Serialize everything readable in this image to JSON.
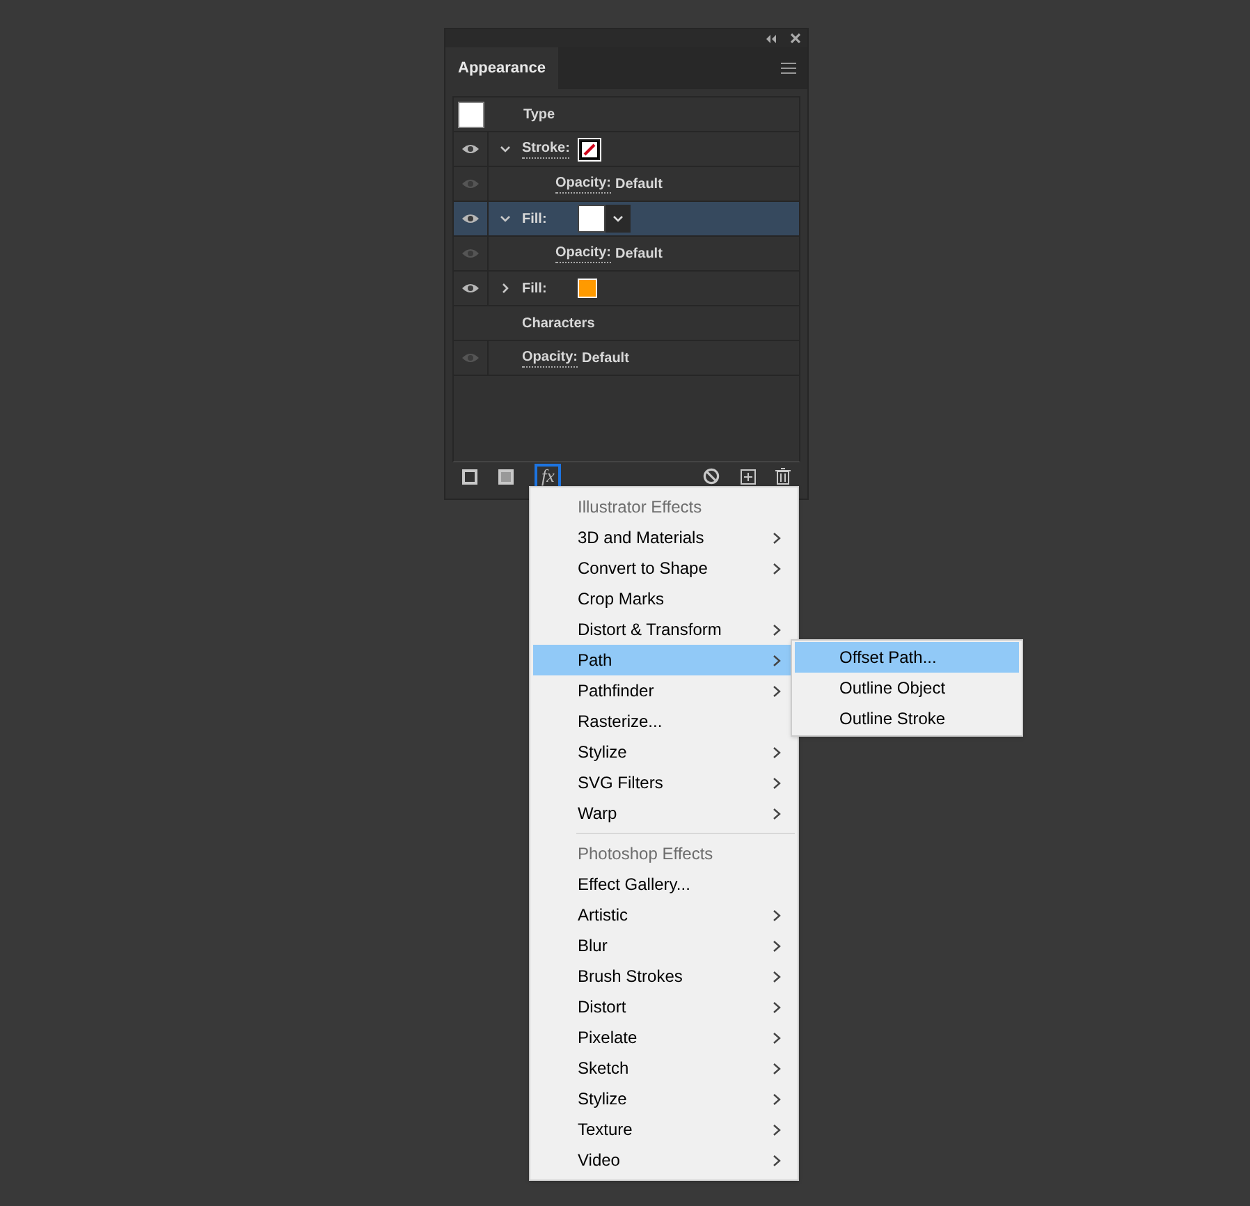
{
  "panel": {
    "tab": "Appearance",
    "selected_tab": true
  },
  "rows": [
    {
      "kind": "header",
      "label": "Type"
    },
    {
      "kind": "attribute",
      "label": "Stroke:",
      "visible": true,
      "expanded": true,
      "selected": false,
      "no_paint": true,
      "color": "#ffffff",
      "children": [
        {
          "kind": "opacity",
          "label": "Opacity:",
          "value": "Default",
          "visible": false
        }
      ]
    },
    {
      "kind": "attribute",
      "label": "Fill:",
      "visible": true,
      "expanded": true,
      "selected": true,
      "no_paint": false,
      "color": "#ffffff",
      "dropdown": true,
      "children": [
        {
          "kind": "opacity",
          "label": "Opacity:",
          "value": "Default",
          "visible": false
        }
      ]
    },
    {
      "kind": "attribute",
      "label": "Fill:",
      "visible": true,
      "expanded": false,
      "selected": false,
      "no_paint": false,
      "color": "#ff9a00",
      "dropdown": false
    },
    {
      "kind": "plain",
      "label": "Characters"
    },
    {
      "kind": "opacity",
      "label": "Opacity:",
      "value": "Default",
      "visible": false
    }
  ],
  "footer": {
    "fx_label": "fx",
    "fx_selected": true
  },
  "menu": {
    "sections": [
      {
        "header": "Illustrator Effects",
        "items": [
          {
            "label": "3D and Materials",
            "submenu": true,
            "selected": false
          },
          {
            "label": "Convert to Shape",
            "submenu": true,
            "selected": false
          },
          {
            "label": "Crop Marks",
            "submenu": false,
            "selected": false
          },
          {
            "label": "Distort & Transform",
            "submenu": true,
            "selected": false
          },
          {
            "label": "Path",
            "submenu": true,
            "selected": true
          },
          {
            "label": "Pathfinder",
            "submenu": true,
            "selected": false
          },
          {
            "label": "Rasterize...",
            "submenu": false,
            "selected": false
          },
          {
            "label": "Stylize",
            "submenu": true,
            "selected": false
          },
          {
            "label": "SVG Filters",
            "submenu": true,
            "selected": false
          },
          {
            "label": "Warp",
            "submenu": true,
            "selected": false
          }
        ]
      },
      {
        "header": "Photoshop Effects",
        "items": [
          {
            "label": "Effect Gallery...",
            "submenu": false,
            "selected": false
          },
          {
            "label": "Artistic",
            "submenu": true,
            "selected": false
          },
          {
            "label": "Blur",
            "submenu": true,
            "selected": false
          },
          {
            "label": "Brush Strokes",
            "submenu": true,
            "selected": false
          },
          {
            "label": "Distort",
            "submenu": true,
            "selected": false
          },
          {
            "label": "Pixelate",
            "submenu": true,
            "selected": false
          },
          {
            "label": "Sketch",
            "submenu": true,
            "selected": false
          },
          {
            "label": "Stylize",
            "submenu": true,
            "selected": false
          },
          {
            "label": "Texture",
            "submenu": true,
            "selected": false
          },
          {
            "label": "Video",
            "submenu": true,
            "selected": false
          }
        ]
      }
    ]
  },
  "submenu": {
    "items": [
      {
        "label": "Offset Path...",
        "selected": true
      },
      {
        "label": "Outline Object",
        "selected": false
      },
      {
        "label": "Outline Stroke",
        "selected": false
      }
    ]
  }
}
